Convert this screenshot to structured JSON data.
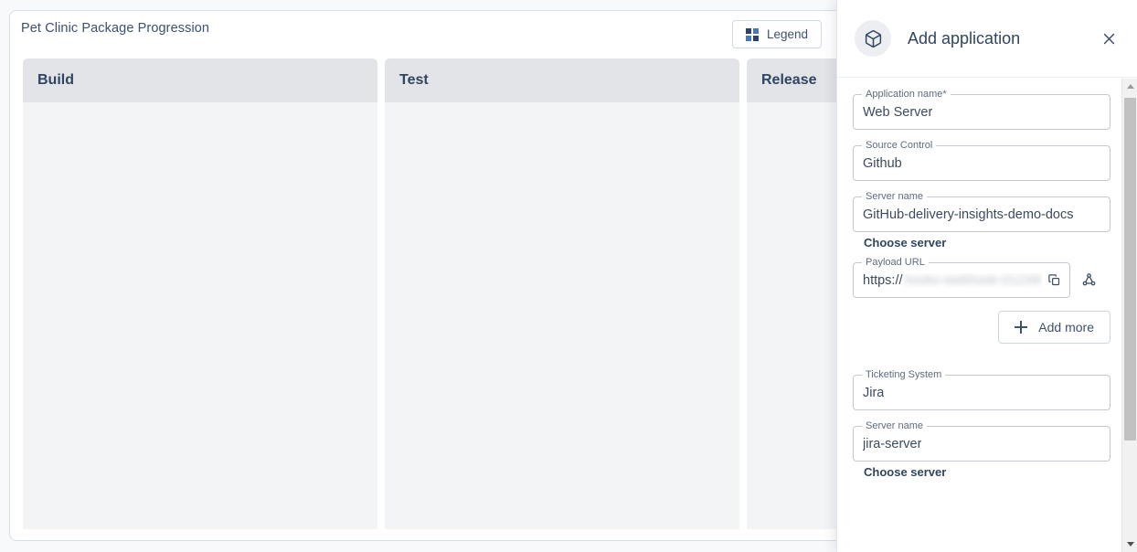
{
  "board": {
    "title": "Pet Clinic Package Progression",
    "legend_button": {
      "label": "Legend",
      "icon": "grid-icon"
    },
    "columns": [
      {
        "label": "Build"
      },
      {
        "label": "Test"
      },
      {
        "label": "Release"
      }
    ]
  },
  "panel": {
    "title": "Add application",
    "icon": "package-box-icon",
    "close_icon": "close-icon",
    "fields": [
      {
        "label": "Application name",
        "required_marker": "*",
        "value": "Web Server"
      },
      {
        "label": "Source Control",
        "required_marker": "",
        "value": "Github"
      },
      {
        "label": "Server name",
        "required_marker": "",
        "value": "GitHub-delivery-insights-demo-docs"
      }
    ],
    "choose_server_1": "Choose server",
    "payload": {
      "label": "Payload URL",
      "protocol": "https://",
      "redacted": "hooks-webhook-01234567ab",
      "copy_icon": "copy-icon",
      "share_icon": "share-nodes-icon"
    },
    "add_more": {
      "label": "Add more",
      "icon": "plus-icon"
    },
    "ticketing": [
      {
        "label": "Ticketing System",
        "required_marker": "",
        "value": "Jira"
      },
      {
        "label": "Server name",
        "required_marker": "",
        "value": "jira-server"
      }
    ],
    "choose_server_2": "Choose server",
    "scrollbar": {
      "up_icon": "chevron-up-icon",
      "down_icon": "chevron-down-icon"
    }
  }
}
